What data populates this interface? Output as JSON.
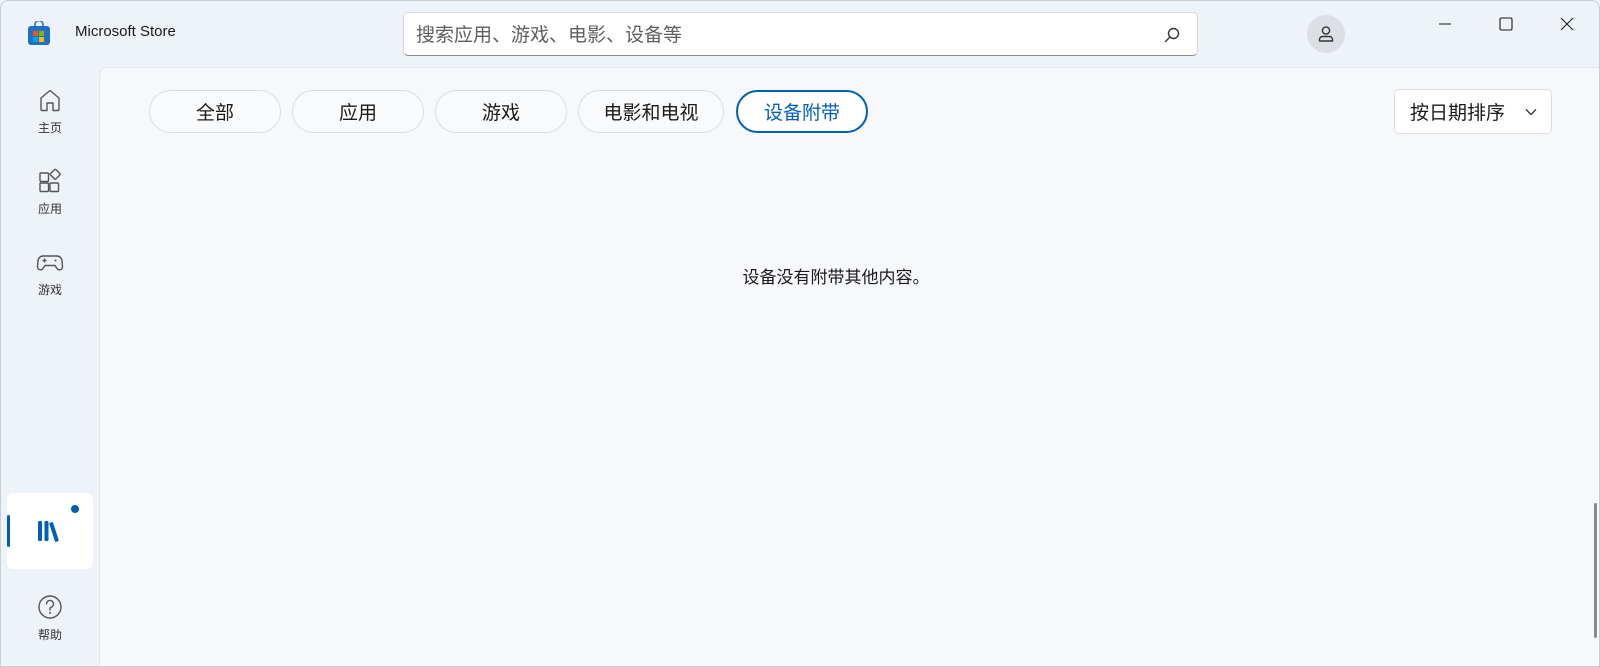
{
  "app": {
    "title": "Microsoft Store"
  },
  "search": {
    "placeholder": "搜索应用、游戏、电影、设备等",
    "value": ""
  },
  "nav": {
    "items": [
      {
        "label": "主页",
        "icon": "home-icon"
      },
      {
        "label": "应用",
        "icon": "apps-icon"
      },
      {
        "label": "游戏",
        "icon": "gamepad-icon"
      }
    ],
    "library": {
      "icon": "library-icon",
      "selected": true,
      "has_notification": true
    },
    "help": {
      "label": "帮助",
      "icon": "help-icon"
    }
  },
  "filters": {
    "tabs": [
      {
        "label": "全部"
      },
      {
        "label": "应用"
      },
      {
        "label": "游戏"
      },
      {
        "label": "电影和电视"
      },
      {
        "label": "设备附带",
        "selected": true
      }
    ]
  },
  "sort": {
    "label": "按日期排序"
  },
  "main": {
    "empty_message": "设备没有附带其他内容。"
  },
  "colors": {
    "accent": "#005fb8",
    "background": "#eef2f9",
    "panel": "#f6f8fc"
  }
}
